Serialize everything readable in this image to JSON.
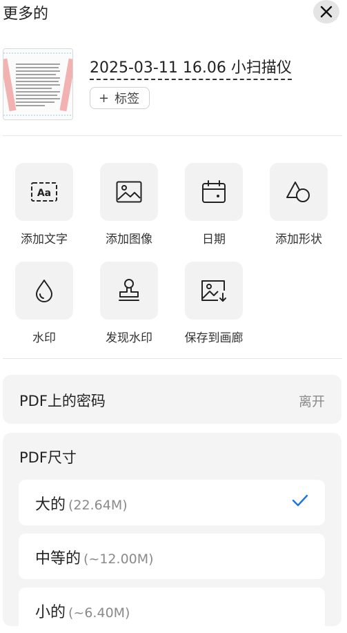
{
  "header": {
    "title": "更多的",
    "close_icon": "close-icon"
  },
  "document": {
    "name": "2025-03-11 16.06 小扫描仪",
    "tag_plus": "+",
    "tag_label": "标签"
  },
  "tools": [
    {
      "label": "添加文字",
      "icon": "text-aa-icon"
    },
    {
      "label": "添加图像",
      "icon": "image-icon"
    },
    {
      "label": "日期",
      "icon": "calendar-icon"
    },
    {
      "label": "添加形状",
      "icon": "shapes-icon"
    },
    {
      "label": "水印",
      "icon": "water-drop-icon"
    },
    {
      "label": "发现水印",
      "icon": "stamp-icon"
    },
    {
      "label": "保存到画廊",
      "icon": "save-image-icon"
    }
  ],
  "password": {
    "label": "PDF上的密码",
    "status": "离开"
  },
  "pdf_size": {
    "title": "PDF尺寸",
    "options": [
      {
        "label": "大的",
        "size": "(22.64M)",
        "selected": true
      },
      {
        "label": "中等的",
        "size": "(~12.00M)",
        "selected": false
      },
      {
        "label": "小的",
        "size": "(~6.40M)",
        "selected": false
      }
    ]
  },
  "colors": {
    "accent": "#1a73e8",
    "card_bg": "#f4f4f4",
    "muted": "#8a8a8a"
  }
}
